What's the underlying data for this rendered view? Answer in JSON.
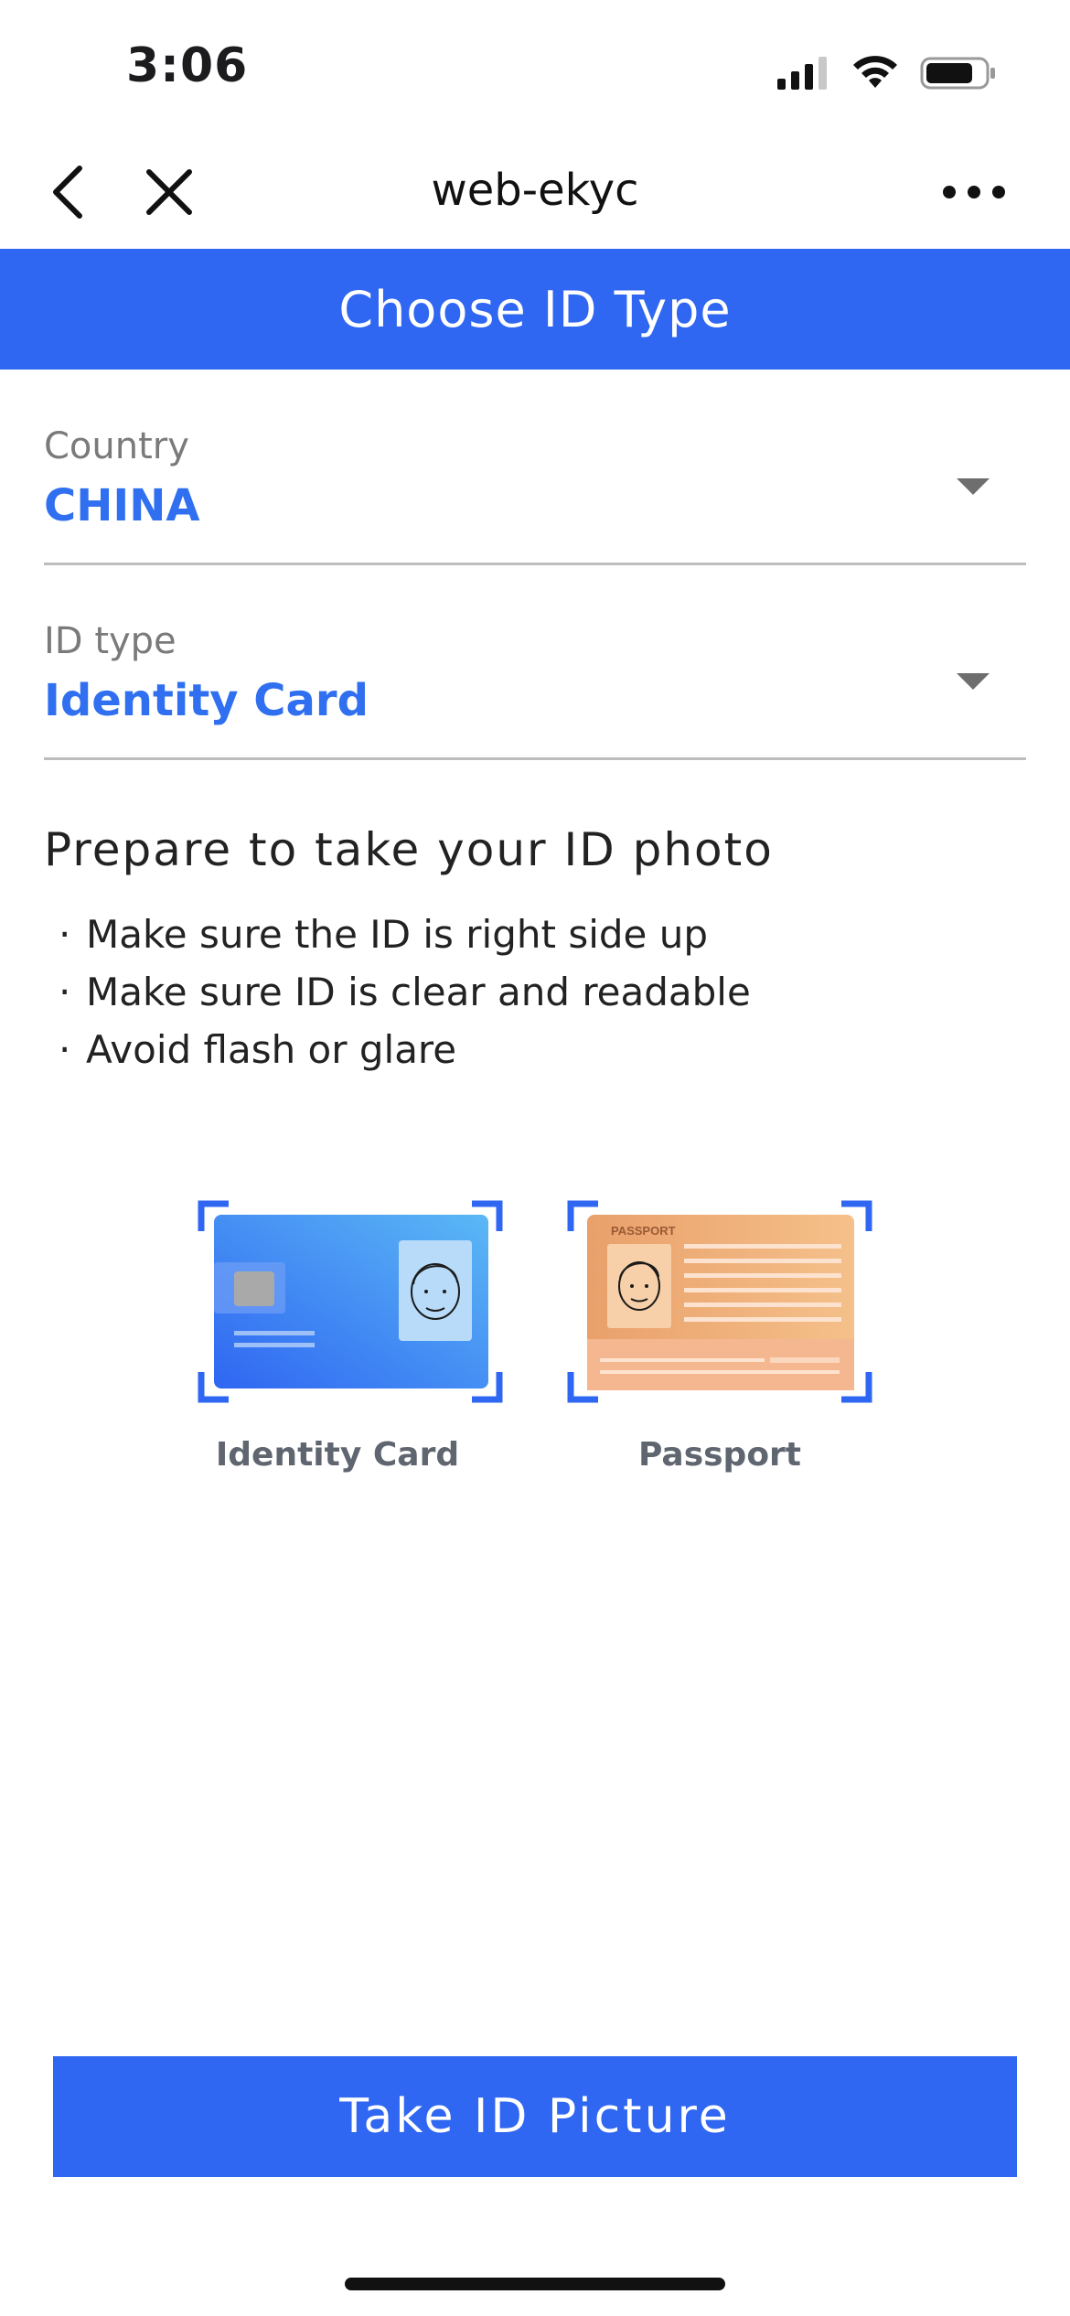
{
  "status_bar": {
    "time": "3:06"
  },
  "nav": {
    "title": "web-ekyc"
  },
  "header": {
    "title": "Choose ID Type"
  },
  "country": {
    "label": "Country",
    "value": "CHINA"
  },
  "id_type": {
    "label": "ID type",
    "value": "Identity Card"
  },
  "instructions": {
    "title": "Prepare to take your ID photo",
    "tips": [
      "Make sure the ID is right side up",
      "Make sure ID is clear and readable",
      "Avoid flash or glare"
    ]
  },
  "documents": {
    "identity_card_label": "Identity Card",
    "passport_label": "Passport",
    "passport_text": "PASSPORT"
  },
  "button": {
    "label": "Take ID Picture"
  },
  "colors": {
    "primary": "#2f66f2",
    "value_text": "#2f6ff0"
  }
}
